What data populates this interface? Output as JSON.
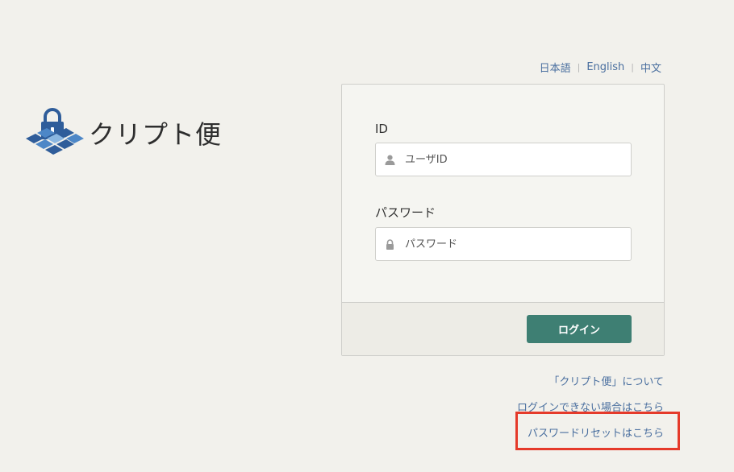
{
  "languages": {
    "japanese": "日本語",
    "english": "English",
    "chinese": "中文",
    "separator": "|"
  },
  "logo": {
    "text": "クリプト便",
    "icon": "padlock-tile-icon"
  },
  "form": {
    "id_label": "ID",
    "id_placeholder": "ユーザID",
    "id_value": "",
    "id_icon": "user-icon",
    "password_label": "パスワード",
    "password_placeholder": "パスワード",
    "password_value": "",
    "password_icon": "lock-icon",
    "login_button": "ログイン"
  },
  "links": {
    "about": "「クリプト便」について",
    "cannot_login": "ログインできない場合はこちら",
    "password_reset": "パスワードリセットはこちら"
  },
  "colors": {
    "background": "#f2f1ec",
    "accent_button": "#3e7f73",
    "link": "#4a6f9f",
    "highlight": "#e53a2a"
  }
}
